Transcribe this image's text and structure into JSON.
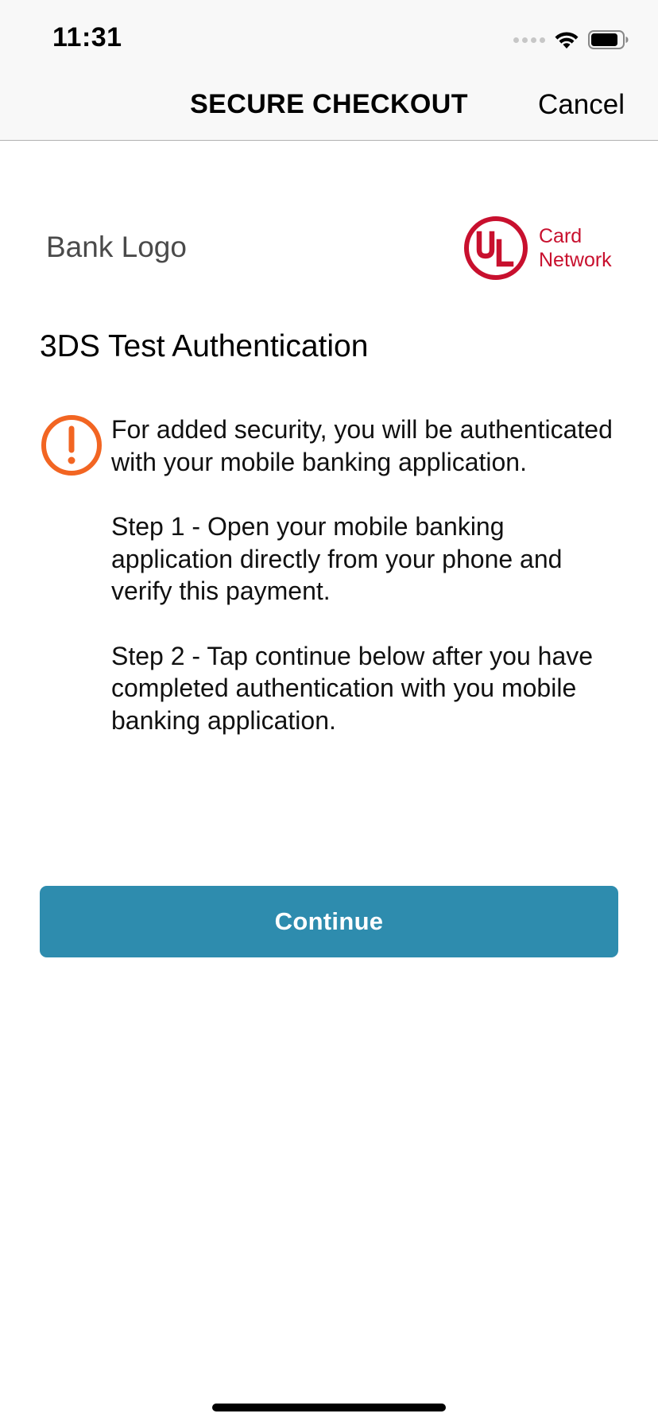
{
  "status_bar": {
    "time": "11:31",
    "signal_icon": "cellular-signal-icon",
    "wifi_icon": "wifi-icon",
    "battery_icon": "battery-icon"
  },
  "nav": {
    "title": "SECURE CHECKOUT",
    "cancel_label": "Cancel"
  },
  "logos": {
    "bank_logo_text": "Bank Logo",
    "network_mark": "UL",
    "network_line1": "Card",
    "network_line2": "Network",
    "network_color": "#c8102e"
  },
  "content": {
    "heading": "3DS Test Authentication",
    "alert_icon": "exclamation-circle-icon",
    "alert_color": "#f26522",
    "paragraphs": [
      "For added security, you will be authenticated with your mobile banking application.",
      "Step 1 - Open your mobile banking application directly from your phone and verify this payment.",
      "Step 2 - Tap continue below after you have completed authentication with you mobile banking application."
    ]
  },
  "actions": {
    "continue_label": "Continue",
    "continue_color": "#2e8cae"
  }
}
